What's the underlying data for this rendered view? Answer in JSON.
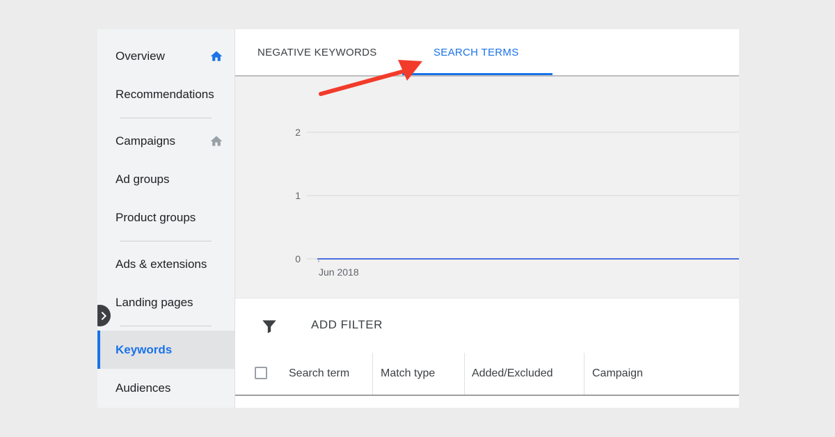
{
  "sidebar": {
    "items": [
      {
        "label": "Overview",
        "icon": "home-icon",
        "icon_color": "#1a73e8"
      },
      {
        "label": "Recommendations"
      },
      {
        "label": "Campaigns",
        "icon": "home-icon",
        "icon_color": "#9aa0a6"
      },
      {
        "label": "Ad groups"
      },
      {
        "label": "Product groups"
      },
      {
        "label": "Ads & extensions"
      },
      {
        "label": "Landing pages"
      },
      {
        "label": "Keywords",
        "active": true
      },
      {
        "label": "Audiences"
      }
    ],
    "collapse_icon": "chevron-right-icon"
  },
  "tabs": [
    {
      "label": "NEGATIVE KEYWORDS"
    },
    {
      "label": "SEARCH TERMS",
      "selected": true
    }
  ],
  "chart_data": {
    "type": "line",
    "x": [
      "Jun 2018"
    ],
    "series": [
      {
        "values": [
          0
        ]
      }
    ],
    "xlabel": "",
    "ylabel": "",
    "ylim": [
      0,
      2
    ],
    "yticks": [
      0,
      1,
      2
    ],
    "xtick_labels": [
      "Jun 2018"
    ],
    "grid": true,
    "line_color": "#4a6fdc"
  },
  "filter": {
    "label": "ADD FILTER",
    "icon": "filter-icon"
  },
  "table": {
    "columns": [
      "Search term",
      "Match type",
      "Added/Excluded",
      "Campaign"
    ]
  },
  "annotation": {
    "icon": "red-arrow-icon",
    "color": "#f23b2a"
  },
  "colors": {
    "accent": "#1a73e8",
    "sidebar_bg": "#f1f3f4",
    "chart_bg": "#f1f1f1"
  }
}
